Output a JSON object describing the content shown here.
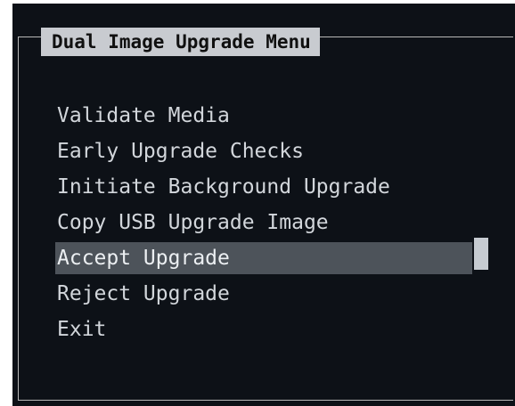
{
  "window": {
    "title": "Dual Image Upgrade Menu"
  },
  "menu": {
    "selected_index": 4,
    "items": [
      {
        "label": "Validate Media"
      },
      {
        "label": "Early Upgrade Checks"
      },
      {
        "label": "Initiate Background Upgrade"
      },
      {
        "label": "Copy USB Upgrade Image"
      },
      {
        "label": "Accept Upgrade"
      },
      {
        "label": "Reject Upgrade"
      },
      {
        "label": "Exit"
      }
    ]
  },
  "colors": {
    "background": "#0d1117",
    "text": "#d2d6db",
    "title_bar": "#c8cbd0",
    "selection": "#4d535a",
    "cursor": "#c6cbd1"
  }
}
